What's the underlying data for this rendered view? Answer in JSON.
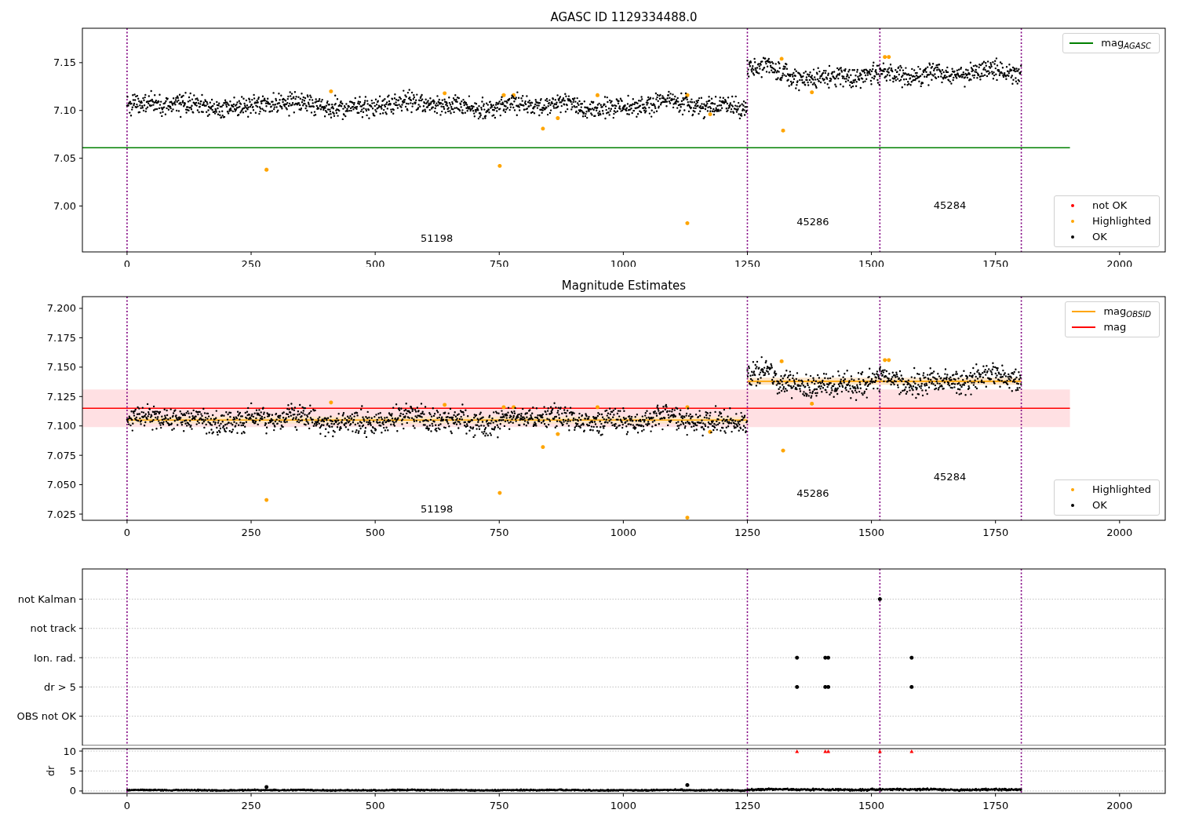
{
  "figure": {
    "panels": [
      {
        "chart_data": {
          "type": "scatter",
          "title": "AGASC ID 1129334488.0",
          "xlim": [
            -90,
            2092
          ],
          "ylim": [
            6.952,
            7.186
          ],
          "xticks": [
            0,
            250,
            500,
            750,
            1000,
            1250,
            1500,
            1750,
            2000
          ],
          "yticks": [
            {
              "value": 7.0,
              "label": "7.00"
            },
            {
              "value": 7.05,
              "label": "7.05"
            },
            {
              "value": 7.1,
              "label": "7.10"
            },
            {
              "value": 7.15,
              "label": "7.15"
            }
          ],
          "series": [
            {
              "type": "line",
              "color": "#008000",
              "x": [
                -90,
                1900
              ],
              "values": [
                7.061,
                7.061
              ]
            },
            {
              "color": "#ffa500",
              "x": [
                281,
                411,
                640,
                759,
                779,
                751,
                838,
                868,
                948,
                1129,
                1129,
                1175,
                1319,
                1322,
                1380,
                1527,
                1535
              ],
              "values": [
                7.038,
                7.12,
                7.118,
                7.116,
                7.116,
                7.042,
                7.081,
                7.092,
                7.116,
                7.116,
                6.982,
                7.096,
                7.154,
                7.079,
                7.119,
                7.156,
                7.156
              ]
            }
          ],
          "ref_lines": [
            {
              "axis": "x",
              "value": 0,
              "color": "#800080"
            },
            {
              "axis": "x",
              "value": 1250,
              "color": "#800080"
            },
            {
              "axis": "x",
              "value": 1517,
              "color": "#800080"
            },
            {
              "axis": "x",
              "value": 1802,
              "color": "#800080"
            }
          ],
          "annotations": [
            "51198",
            "45286",
            "45284"
          ]
        },
        "legends": [
          {
            "entries": [
              {
                "label": "mag$_{AGASC}$",
                "color": "#008000",
                "kind": "line"
              }
            ]
          },
          {
            "entries": [
              {
                "label": "not OK",
                "color": "#ff0000",
                "kind": "dot"
              },
              {
                "label": "Highlighted",
                "color": "#ffa500",
                "kind": "dot"
              },
              {
                "label": "OK",
                "color": "#000000",
                "kind": "dot"
              }
            ]
          }
        ]
      },
      {
        "chart_data": {
          "type": "scatter",
          "title": "Magnitude Estimates",
          "xlim": [
            -90,
            2092
          ],
          "ylim": [
            7.0197,
            7.21
          ],
          "xticks": [
            0,
            250,
            500,
            750,
            1000,
            1250,
            1500,
            1750,
            2000
          ],
          "yticks": [
            {
              "value": 7.025,
              "label": "7.025"
            },
            {
              "value": 7.05,
              "label": "7.050"
            },
            {
              "value": 7.075,
              "label": "7.075"
            },
            {
              "value": 7.1,
              "label": "7.100"
            },
            {
              "value": 7.125,
              "label": "7.125"
            },
            {
              "value": 7.15,
              "label": "7.150"
            },
            {
              "value": 7.175,
              "label": "7.175"
            },
            {
              "value": 7.2,
              "label": "7.200"
            }
          ],
          "bands": [
            {
              "axis": "y",
              "from": 7.099,
              "to": 7.131,
              "color": "#ffe0e3"
            },
            {
              "axis": "y",
              "from": 7.102,
              "to": 7.108,
              "color": "#fde5c8"
            },
            {
              "axis": "y",
              "from": 7.135,
              "to": 7.141,
              "color": "#fde5c8"
            }
          ],
          "series": [
            {
              "type": "line",
              "color": "#ff0000",
              "x": [
                -90,
                1900
              ],
              "values": [
                7.115,
                7.115
              ]
            },
            {
              "type": "line",
              "color": "#ffa500",
              "x": [
                0,
                1250
              ],
              "values": [
                7.105,
                7.105
              ]
            },
            {
              "type": "line",
              "color": "#ffa500",
              "x": [
                1250,
                1802
              ],
              "values": [
                7.138,
                7.138
              ]
            },
            {
              "color": "#ffa500",
              "x": [
                281,
                411,
                640,
                759,
                779,
                751,
                838,
                868,
                948,
                1129,
                1129,
                1175,
                1319,
                1322,
                1380,
                1527,
                1535
              ],
              "values": [
                7.037,
                7.12,
                7.118,
                7.116,
                7.116,
                7.043,
                7.082,
                7.093,
                7.116,
                7.116,
                7.022,
                7.095,
                7.155,
                7.079,
                7.119,
                7.156,
                7.156
              ]
            }
          ],
          "ref_lines": [
            {
              "axis": "x",
              "value": 0,
              "color": "#800080"
            },
            {
              "axis": "x",
              "value": 1250,
              "color": "#800080"
            },
            {
              "axis": "x",
              "value": 1517,
              "color": "#800080"
            },
            {
              "axis": "x",
              "value": 1802,
              "color": "#800080"
            }
          ],
          "annotations": [
            "51198",
            "45286",
            "45284"
          ]
        },
        "legends": [
          {
            "entries": [
              {
                "label": "mag$_{OBSID}$",
                "color": "#ffa500",
                "kind": "line"
              },
              {
                "label": "mag",
                "color": "#ff0000",
                "kind": "line"
              }
            ]
          },
          {
            "entries": [
              {
                "label": "Highlighted",
                "color": "#ffa500",
                "kind": "dot"
              },
              {
                "label": "OK",
                "color": "#000000",
                "kind": "dot"
              }
            ]
          }
        ]
      },
      {
        "chart_data": {
          "type": "scatter",
          "orientation": "horizontal",
          "xlim": [
            -90,
            2092
          ],
          "grid": true,
          "categories": [
            "not Kalman",
            "not track",
            "Ion. rad.",
            "dr > 5",
            "OBS not OK"
          ],
          "series": [
            {
              "color": "#000000",
              "values": [
                null,
                null,
                1350,
                1350,
                null
              ]
            },
            {
              "color": "#000000",
              "values": [
                null,
                null,
                1407,
                1407,
                null
              ]
            },
            {
              "color": "#000000",
              "values": [
                null,
                null,
                1413,
                1413,
                null
              ]
            },
            {
              "color": "#000000",
              "values": [
                1517,
                null,
                1581,
                1581,
                null
              ]
            }
          ]
        }
      },
      {
        "chart_data": {
          "type": "scatter",
          "ylabel": "dr",
          "xlim": [
            -90,
            2092
          ],
          "ylim": [
            -0.6,
            10.6
          ],
          "grid": true,
          "xticks": [
            0,
            250,
            500,
            750,
            1000,
            1250,
            1500,
            1750,
            2000
          ],
          "yticks": [
            0,
            5,
            10
          ],
          "series": [
            {
              "color": "#000000",
              "x": [
                281,
                1129
              ],
              "values": [
                1.0,
                1.5
              ]
            },
            {
              "color": "#ff0000",
              "marker": "^",
              "x": [
                1350,
                1407,
                1413,
                1517,
                1581
              ],
              "values": [
                9.9,
                9.9,
                9.9,
                9.9,
                9.9
              ]
            }
          ],
          "ref_lines": [
            {
              "axis": "x",
              "value": 0,
              "color": "#800080"
            },
            {
              "axis": "x",
              "value": 1250,
              "color": "#800080"
            },
            {
              "axis": "x",
              "value": 1517,
              "color": "#800080"
            },
            {
              "axis": "x",
              "value": 1802,
              "color": "#800080"
            }
          ]
        }
      }
    ]
  }
}
